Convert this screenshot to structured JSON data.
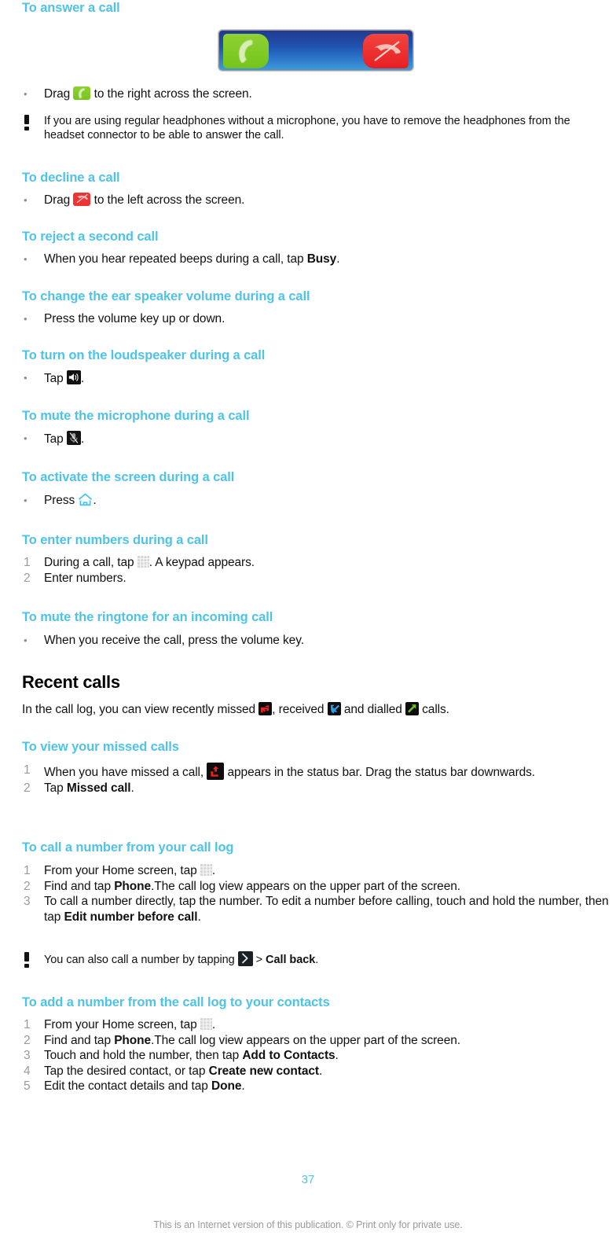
{
  "document": {
    "page_number": "37",
    "footer_note": "This is an Internet version of this publication. © Print only for private use.",
    "heading_color": "#4ec3e8"
  },
  "sections": [
    {
      "id": "answer-a-call",
      "heading": "To answer a call",
      "figure": {
        "name": "incoming-call-slider",
        "answer_icon": "answer-call-icon",
        "decline_icon": "decline-call-icon"
      },
      "steps": [
        {
          "marker": "bullet",
          "pre": "Drag ",
          "icon": "answer-call-icon",
          "post": " to the right across the screen."
        }
      ],
      "note": "If you are using regular headphones without a microphone, you have to remove the headphones from the headset connector to be able to answer the call."
    },
    {
      "id": "decline-a-call",
      "heading": "To decline a call",
      "steps": [
        {
          "marker": "bullet",
          "pre": "Drag ",
          "icon": "decline-call-icon",
          "post": " to the left across the screen."
        }
      ]
    },
    {
      "id": "reject-second-call",
      "heading": "To reject a second call",
      "steps": [
        {
          "marker": "bullet",
          "pre": "When you hear repeated beeps during a call, tap ",
          "bold": "Busy",
          "post": "."
        }
      ]
    },
    {
      "id": "change-ear-speaker-volume",
      "heading": "To change the ear speaker volume during a call",
      "steps": [
        {
          "marker": "bullet",
          "pre": "Press the volume key up or down."
        }
      ]
    },
    {
      "id": "turn-on-loudspeaker",
      "heading": "To turn on the loudspeaker during a call",
      "steps": [
        {
          "marker": "bullet",
          "pre": "Tap ",
          "icon": "loudspeaker-icon",
          "post": "."
        }
      ]
    },
    {
      "id": "mute-microphone",
      "heading": "To mute the microphone during a call",
      "steps": [
        {
          "marker": "bullet",
          "pre": "Tap ",
          "icon": "mute-microphone-icon",
          "post": "."
        }
      ]
    },
    {
      "id": "activate-screen",
      "heading": "To activate the screen during a call",
      "steps": [
        {
          "marker": "bullet",
          "pre": "Press ",
          "icon": "home-icon",
          "post": "."
        }
      ]
    },
    {
      "id": "enter-numbers",
      "heading": "To enter numbers during a call",
      "steps": [
        {
          "marker": "1",
          "pre": "During a call, tap ",
          "icon": "keypad-icon",
          "post": ". A keypad appears."
        },
        {
          "marker": "2",
          "pre": "Enter numbers."
        }
      ]
    },
    {
      "id": "mute-ringtone",
      "heading": "To mute the ringtone for an incoming call",
      "steps": [
        {
          "marker": "bullet",
          "pre": "When you receive the call, press the volume key."
        }
      ]
    }
  ],
  "recent_calls": {
    "heading": "Recent calls",
    "intro": {
      "part1": "In the call log, you can view recently missed ",
      "missed_icon": "missed-call-icon",
      "part2": ", received ",
      "received_icon": "received-call-icon",
      "part3": " and dialled ",
      "dialled_icon": "dialled-call-icon",
      "part4": " calls."
    },
    "subsections": [
      {
        "id": "view-missed-calls",
        "heading": "To view your missed calls",
        "steps": [
          {
            "marker": "1",
            "pre": "When you have missed a call, ",
            "icon": "missed-call-status-icon",
            "post": " appears in the status bar. Drag the status bar downwards."
          },
          {
            "marker": "2",
            "pre": "Tap ",
            "bold": "Missed call",
            "post": "."
          }
        ]
      },
      {
        "id": "call-number-from-call-log",
        "heading": "To call a number from your call log",
        "steps": [
          {
            "marker": "1",
            "pre": "From your Home screen, tap ",
            "icon": "keypad-icon",
            "post": "."
          },
          {
            "marker": "2",
            "pre": "Find and tap ",
            "bold": "Phone",
            "post": ".The call log view appears on the upper part of the screen."
          },
          {
            "marker": "3",
            "pre": "To call a number directly, tap the number. To edit a number before calling, touch and hold the number, then tap ",
            "bold": "Edit number before call",
            "post": "."
          }
        ],
        "note": {
          "part1": "You can also call a number by tapping ",
          "icon": "chevron-right-icon",
          "part2": " > ",
          "bold": "Call back",
          "part3": "."
        }
      },
      {
        "id": "add-number-to-contacts",
        "heading": "To add a number from the call log to your contacts",
        "steps": [
          {
            "marker": "1",
            "pre": "From your Home screen, tap ",
            "icon": "keypad-icon",
            "post": "."
          },
          {
            "marker": "2",
            "pre": "Find and tap ",
            "bold": "Phone",
            "post": ".The call log view appears on the upper part of the screen."
          },
          {
            "marker": "3",
            "pre": "Touch and hold the number, then tap ",
            "bold": "Add to Contacts",
            "post": "."
          },
          {
            "marker": "4",
            "pre": "Tap the desired contact, or tap ",
            "bold": "Create new contact",
            "post": "."
          },
          {
            "marker": "5",
            "pre": "Edit the contact details and tap ",
            "bold": "Done",
            "post": "."
          }
        ]
      }
    ]
  }
}
